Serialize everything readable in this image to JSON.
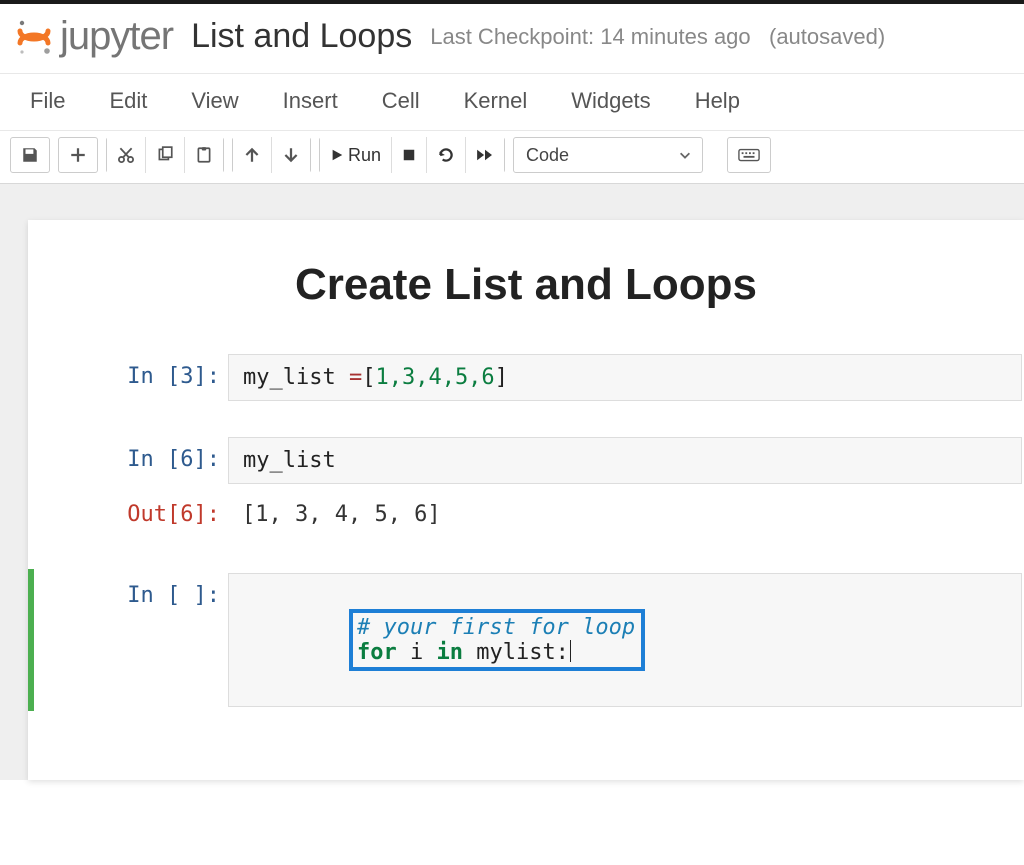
{
  "header": {
    "logo_text": "jupyter",
    "notebook_title": "List and Loops",
    "checkpoint_prefix": "Last Checkpoint: ",
    "checkpoint_time": "14 minutes ago",
    "autosaved": "(autosaved)"
  },
  "menubar": {
    "file": "File",
    "edit": "Edit",
    "view": "View",
    "insert": "Insert",
    "cell": "Cell",
    "kernel": "Kernel",
    "widgets": "Widgets",
    "help": "Help"
  },
  "toolbar": {
    "run_label": "Run",
    "celltype_selected": "Code",
    "icons": {
      "save": "save-icon",
      "add": "plus-icon",
      "cut": "scissors-icon",
      "copy": "copy-icon",
      "paste": "paste-icon",
      "up": "arrow-up-icon",
      "down": "arrow-down-icon",
      "run": "play-icon",
      "stop": "stop-icon",
      "restart": "refresh-icon",
      "fastfwd": "fast-forward-icon",
      "palette": "keyboard-icon"
    }
  },
  "notebook": {
    "heading": "Create List and Loops",
    "cells": [
      {
        "prompt_in": "In [3]:",
        "code_plain1": "my_list ",
        "code_op": "=",
        "code_plain2": "[",
        "code_nums": "1,3,4,5,6",
        "code_plain3": "]"
      },
      {
        "prompt_in": "In [6]:",
        "code": "my_list",
        "prompt_out": "Out[6]:",
        "output": "[1, 3, 4, 5, 6]"
      },
      {
        "prompt_in": "In [ ]:",
        "comment": "# your first for loop",
        "kw_for": "for",
        "kw_in": "in",
        "var_i": " i ",
        "rest": " mylist:"
      }
    ]
  }
}
